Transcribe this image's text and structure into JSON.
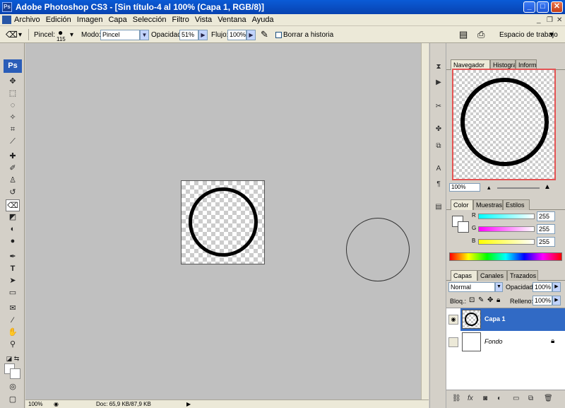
{
  "window": {
    "title": "Adobe Photoshop CS3 - [Sin título-4 al 100% (Capa 1, RGB/8)]"
  },
  "menu": {
    "items": [
      "Archivo",
      "Edición",
      "Imagen",
      "Capa",
      "Selección",
      "Filtro",
      "Vista",
      "Ventana",
      "Ayuda"
    ]
  },
  "options": {
    "brush_label": "Pincel:",
    "brush_size": "115",
    "mode_label": "Modo:",
    "mode_value": "Pincel",
    "opacity_label": "Opacidad:",
    "opacity_value": "51%",
    "flow_label": "Flujo:",
    "flow_value": "100%",
    "erase_history": "Borrar a historia",
    "workspace": "Espacio de trabajo"
  },
  "toolbox": {
    "logo": "Ps"
  },
  "status": {
    "zoom": "100%",
    "doc": "Doc: 65,9 KB/87,9 KB"
  },
  "navigator": {
    "tabs": [
      "Navegador",
      "Histograma",
      "Información"
    ],
    "zoom": "100%"
  },
  "color": {
    "tabs": [
      "Color",
      "Muestras",
      "Estilos"
    ],
    "r_label": "R",
    "g_label": "G",
    "b_label": "B",
    "r": "255",
    "g": "255",
    "b": "255"
  },
  "layers": {
    "tabs": [
      "Capas",
      "Canales",
      "Trazados"
    ],
    "blend": "Normal",
    "opacity_label": "Opacidad:",
    "opacity": "100%",
    "lock_label": "Bloq.:",
    "fill_label": "Relleno:",
    "fill": "100%",
    "items": [
      {
        "name": "Capa 1",
        "selected": true
      },
      {
        "name": "Fondo",
        "selected": false
      }
    ]
  },
  "colors": {
    "accent": "#316ac5",
    "title": "#0a5bd6"
  }
}
